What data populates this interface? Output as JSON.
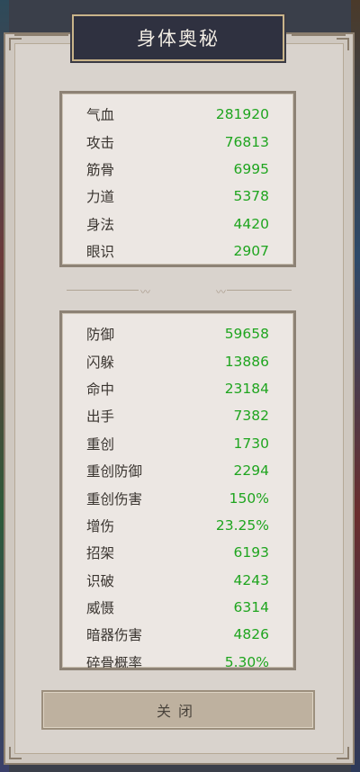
{
  "title": "身体奥秘",
  "section1": [
    {
      "label": "气血",
      "value": "281920"
    },
    {
      "label": "攻击",
      "value": "76813"
    },
    {
      "label": "筋骨",
      "value": "6995"
    },
    {
      "label": "力道",
      "value": "5378"
    },
    {
      "label": "身法",
      "value": "4420"
    },
    {
      "label": "眼识",
      "value": "2907"
    }
  ],
  "section2": [
    {
      "label": "防御",
      "value": "59658"
    },
    {
      "label": "闪躲",
      "value": "13886"
    },
    {
      "label": "命中",
      "value": "23184"
    },
    {
      "label": "出手",
      "value": "7382"
    },
    {
      "label": "重创",
      "value": "1730"
    },
    {
      "label": "重创防御",
      "value": "2294"
    },
    {
      "label": "重创伤害",
      "value": "150%"
    },
    {
      "label": "增伤",
      "value": "23.25%"
    },
    {
      "label": "招架",
      "value": "6193"
    },
    {
      "label": "识破",
      "value": "4243"
    },
    {
      "label": "威慑",
      "value": "6314"
    },
    {
      "label": "暗器伤害",
      "value": "4826"
    },
    {
      "label": "碎骨概率",
      "value": "5.30%"
    }
  ],
  "close_label": "关闭",
  "colors": {
    "value": "#1fa51f",
    "label": "#3a3530",
    "title_bg": "#2f3140"
  }
}
